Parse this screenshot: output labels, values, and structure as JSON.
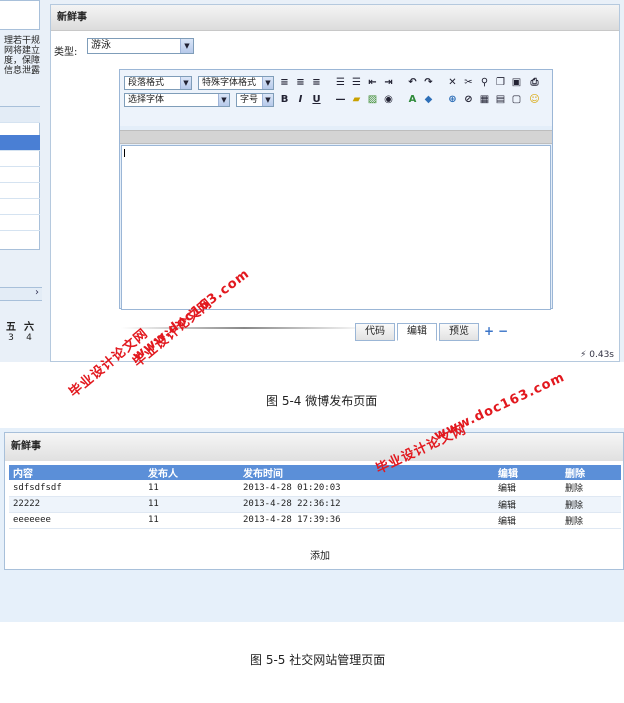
{
  "figure1": {
    "left_panel": {
      "text_lines": [
        "理若干规",
        "网将建立",
        "度，保障",
        "信息泄露"
      ],
      "calendar_days": [
        "五",
        "六"
      ],
      "calendar_nums": [
        "3",
        "4"
      ],
      "calendar_next": "›"
    },
    "panel_title": "新鲜事",
    "type_label": "类型:",
    "type_value": "游泳",
    "toolbar": {
      "paragraph_format": "段落格式",
      "special_font": "特殊字体格式",
      "select_font": "选择字体",
      "font_size": "字号",
      "bold": "B",
      "italic": "I",
      "underline": "U"
    },
    "tabs": {
      "code": "代码",
      "edit": "编辑",
      "preview": "预览"
    },
    "timer": "0.43s"
  },
  "caption1": "图 5-4 微博发布页面",
  "figure2": {
    "panel_title": "新鲜事",
    "columns": [
      "内容",
      "发布人",
      "发布时间",
      "编辑",
      "删除"
    ],
    "rows": [
      [
        "sdfsdfsdf",
        "11",
        "2013-4-28 01:20:03",
        "编辑",
        "删除"
      ],
      [
        "22222",
        "11",
        "2013-4-28 22:36:12",
        "编辑",
        "删除"
      ],
      [
        "eeeeeee",
        "11",
        "2013-4-28 17:39:36",
        "编辑",
        "删除"
      ]
    ],
    "add_label": "添加"
  },
  "caption2": "图 5-5 社交网站管理页面",
  "watermarks": {
    "brand": "毕业设计论文网",
    "url": "www.doc163.com"
  },
  "colors": {
    "table_header": "#5b8fd8",
    "watermark": "#e2181e",
    "selected_row": "#4a7fd4"
  }
}
